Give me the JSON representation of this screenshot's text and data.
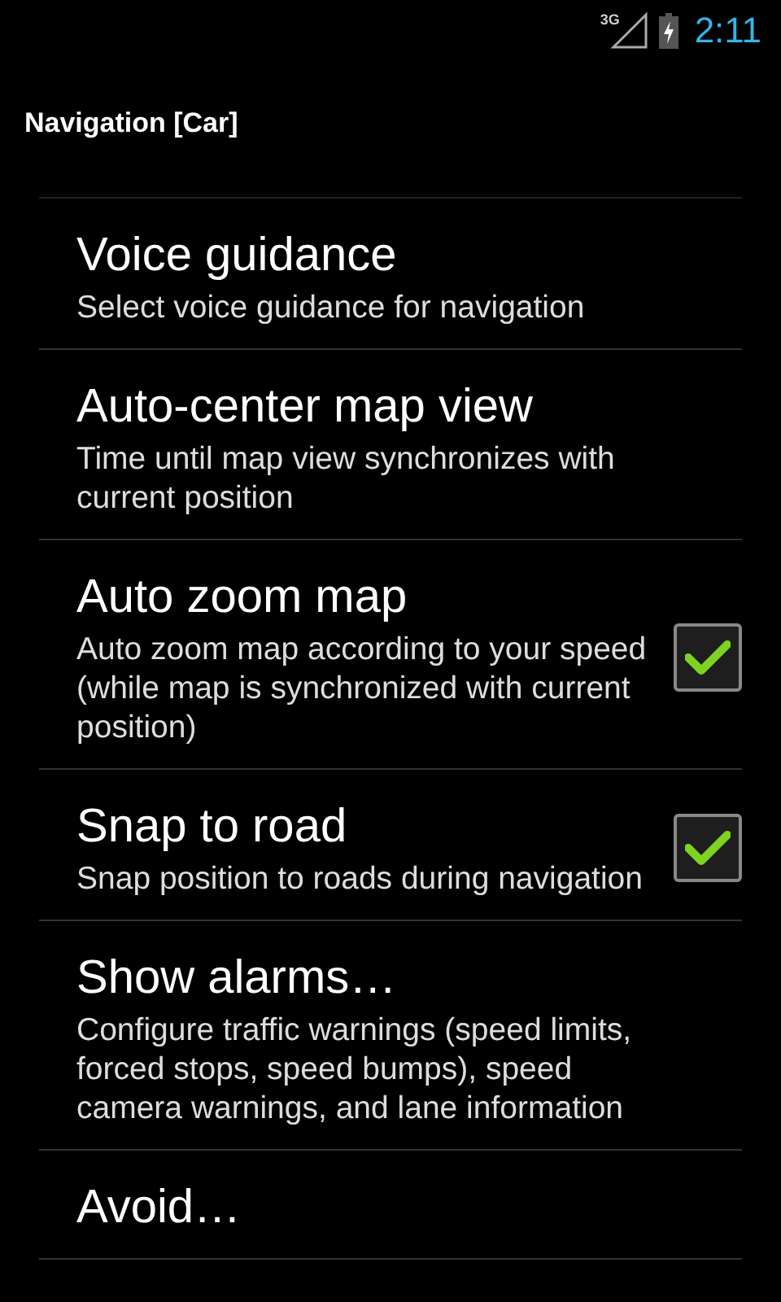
{
  "status_bar": {
    "network": "3G",
    "time": "2:11"
  },
  "header": {
    "title": "Navigation [Car]"
  },
  "preferences": [
    {
      "kind": "plain",
      "title": "Voice guidance",
      "summary": "Select voice guidance for navigation"
    },
    {
      "kind": "plain",
      "title": "Auto-center map view",
      "summary": "Time until map view synchronizes with current position"
    },
    {
      "kind": "checkbox",
      "title": "Auto zoom map",
      "summary": "Auto zoom map according to your speed (while map is synchronized with current position)",
      "checked": true
    },
    {
      "kind": "checkbox",
      "title": "Snap to road",
      "summary": "Snap position to roads during navigation",
      "checked": true
    },
    {
      "kind": "plain",
      "title": "Show alarms…",
      "summary": "Configure traffic warnings (speed limits, forced stops, speed bumps), speed camera warnings, and lane information"
    },
    {
      "kind": "plain",
      "title": "Avoid…"
    }
  ]
}
